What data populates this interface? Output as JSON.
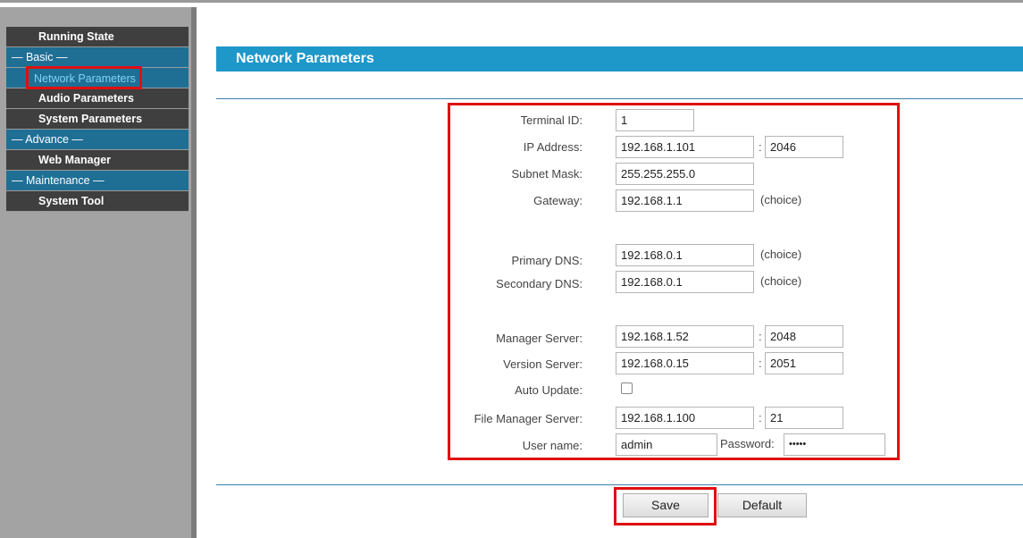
{
  "sidebar": {
    "items": [
      {
        "label": "Running State",
        "kind": "item"
      },
      {
        "label": "— Basic —",
        "kind": "section"
      },
      {
        "label": "Network Parameters",
        "kind": "active"
      },
      {
        "label": "Audio Parameters",
        "kind": "item"
      },
      {
        "label": "System Parameters",
        "kind": "item"
      },
      {
        "label": "— Advance —",
        "kind": "section"
      },
      {
        "label": "Web Manager",
        "kind": "item"
      },
      {
        "label": "— Maintenance —",
        "kind": "section"
      },
      {
        "label": "System Tool",
        "kind": "item"
      }
    ]
  },
  "page_title": "Network Parameters",
  "form": {
    "terminal_id": {
      "label": "Terminal ID:",
      "value": "1"
    },
    "ip_address": {
      "label": "IP Address:",
      "value": "192.168.1.101",
      "port": "2046"
    },
    "subnet_mask": {
      "label": "Subnet Mask:",
      "value": "255.255.255.0"
    },
    "gateway": {
      "label": "Gateway:",
      "value": "192.168.1.1",
      "note": "(choice)"
    },
    "primary_dns": {
      "label": "Primary DNS:",
      "value": "192.168.0.1",
      "note": "(choice)"
    },
    "secondary_dns": {
      "label": "Secondary DNS:",
      "value": "192.168.0.1",
      "note": "(choice)"
    },
    "manager_server": {
      "label": "Manager Server:",
      "value": "192.168.1.52",
      "port": "2048"
    },
    "version_server": {
      "label": "Version Server:",
      "value": "192.168.0.15",
      "port": "2051"
    },
    "auto_update": {
      "label": "Auto Update:",
      "checked": false
    },
    "file_manager_server": {
      "label": "File Manager Server:",
      "value": "192.168.1.100",
      "port": "21"
    },
    "user_name": {
      "label": "User name:",
      "value": "admin"
    },
    "password": {
      "label": "Password:",
      "value": "•••••"
    },
    "colon": ":"
  },
  "buttons": {
    "save": "Save",
    "default": "Default"
  },
  "colors": {
    "header": "#1e97c9",
    "section": "#1f6f95",
    "highlight": "#e01010",
    "sidebar_bg": "#a3a3a3"
  }
}
